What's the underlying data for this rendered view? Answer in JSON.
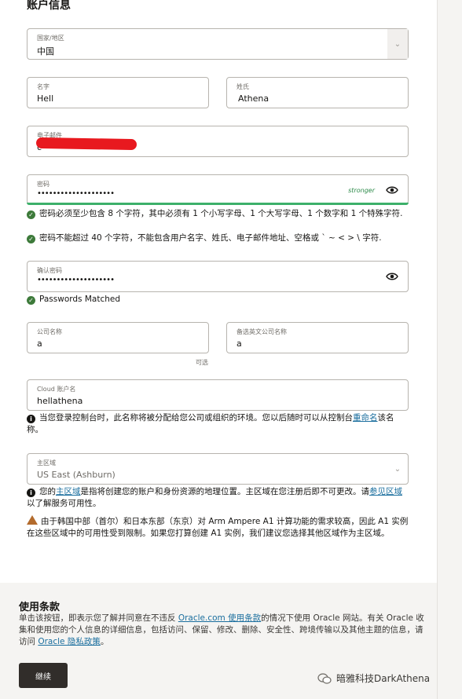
{
  "section_title": "账户信息",
  "country": {
    "label": "国家/地区",
    "value": "中国"
  },
  "first_name": {
    "label": "名字",
    "value": "Hell"
  },
  "last_name": {
    "label": "姓氏",
    "value": "Athena"
  },
  "email": {
    "label": "电子邮件",
    "value": "c"
  },
  "password": {
    "label": "密码",
    "value": "••••••••••••••••••••",
    "strength": "stronger"
  },
  "password_rules": [
    "密码必须至少包含 8 个字符，其中必须有 1 个小写字母、1 个大写字母、1 个数字和 1 个特殊字符.",
    "密码不能超过 40 个字符，不能包含用户名字、姓氏、电子邮件地址、空格或 ` ~ < > \\ 字符."
  ],
  "confirm_password": {
    "label": "确认密码",
    "value": "••••••••••••••••••••"
  },
  "match_message": "Passwords Matched",
  "company_name": {
    "label": "公司名称",
    "value": "a",
    "hint": "可选"
  },
  "alt_company_name": {
    "label": "备选英文公司名称",
    "value": "a"
  },
  "cloud_account": {
    "label": "Cloud 账户名",
    "value": "hellathena"
  },
  "cloud_account_info": {
    "before": "当您登录控制台时，此名称将被分配给您公司或组织的环境。您以后随时可以从控制台",
    "link": "重命名",
    "after": "该名称。"
  },
  "home_region": {
    "label": "主区域",
    "value": "US East (Ashburn)"
  },
  "home_region_info": {
    "before": "您的",
    "link1": "主区域",
    "middle": "是指将创建您的账户和身份资源的地理位置。主区域在您注册后即不可更改。请",
    "link2": "参见区域",
    "after": "以了解服务可用性。"
  },
  "region_warning": "由于韩国中部（首尔）和日本东部（东京）对 Arm Ampere A1 计算功能的需求较高，因此 A1 实例在这些区域中的可用性受到限制。如果您打算创建 A1 实例，我们建议您选择其他区域作为主区域。",
  "terms": {
    "title": "使用条款",
    "text_before": "单击该按钮，即表示您了解并同意在不违反 ",
    "link1": "Oracle.com 使用条款",
    "text_middle": "的情况下使用 Oracle 网站。有关 Oracle 收集和使用您的个人信息的详细信息，包括访问、保留、修改、删除、安全性、跨境传输以及其他主题的信息，请访问 ",
    "link2": "Oracle 隐私政策",
    "text_after": "。"
  },
  "continue_label": "继续",
  "watermark": "暗雅科技DarkAthena",
  "colors": {
    "accent": "#3db06a",
    "link": "#1a6e9e",
    "warning": "#b36b2d",
    "button": "#312d2a"
  }
}
